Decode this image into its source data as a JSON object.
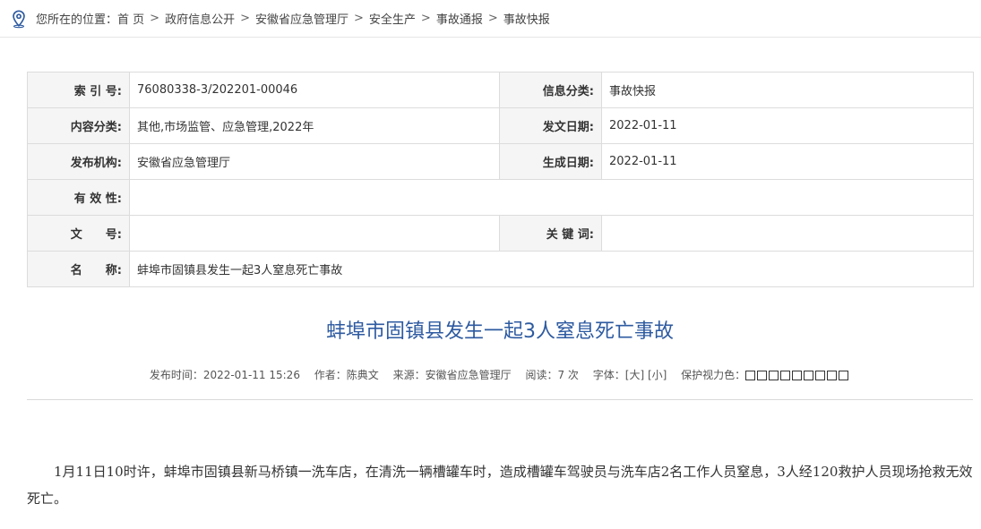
{
  "breadcrumb": {
    "label": "您所在的位置：",
    "items": [
      "首 页",
      "政府信息公开",
      "安徽省应急管理厅",
      "安全生产",
      "事故通报",
      "事故快报"
    ],
    "separator": ">"
  },
  "info": {
    "index_label": "索 引 号:",
    "index_value": "76080338-3/202201-00046",
    "category_label": "信息分类:",
    "category_value": "事故快报",
    "content_label": "内容分类:",
    "content_value": "其他,市场监管、应急管理,2022年",
    "issue_date_label": "发文日期:",
    "issue_date_value": "2022-01-11",
    "publisher_label": "发布机构:",
    "publisher_value": "安徽省应急管理厅",
    "created_date_label": "生成日期:",
    "created_date_value": "2022-01-11",
    "validity_label": "有 效 性:",
    "validity_value": "",
    "doc_no_label": "文　　号:",
    "doc_no_value": "",
    "keywords_label": "关 键 词:",
    "keywords_value": "",
    "name_label": "名　　称:",
    "name_value": "蚌埠市固镇县发生一起3人窒息死亡事故"
  },
  "article": {
    "title": "蚌埠市固镇县发生一起3人窒息死亡事故",
    "meta": {
      "publish_time": "发布时间：2022-01-11 15:26",
      "author": "作者：陈典文",
      "source": "来源：安徽省应急管理厅",
      "views": "阅读：7 次",
      "font_label": "字体：",
      "font_large": "[大]",
      "font_small": "[小]",
      "eye_label": "保护视力色：",
      "eye_colors": [
        "#ffffff",
        "#ffffff",
        "#ffffff",
        "#ffffff",
        "#ffffff",
        "#ffffff",
        "#ffffff",
        "#ffffff",
        "#ffffff"
      ]
    },
    "body": "1月11日10时许，蚌埠市固镇县新马桥镇一洗车店，在清洗一辆槽罐车时，造成槽罐车驾驶员与洗车店2名工作人员窒息，3人经120救护人员现场抢救无效死亡。"
  },
  "colors": {
    "title": "#2d5aa0",
    "icon": "#2d5aa0",
    "label_bg": "#f5f5f5",
    "border": "#dcdcdc"
  }
}
